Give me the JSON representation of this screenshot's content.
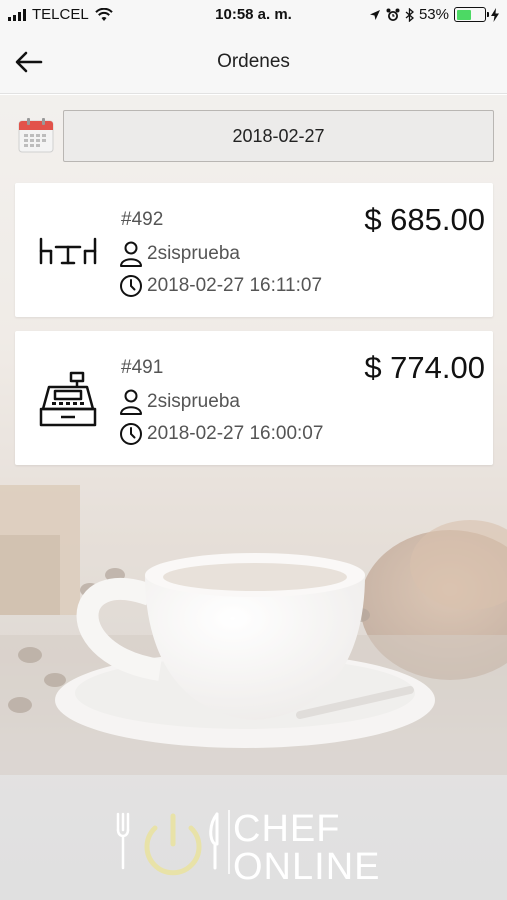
{
  "status_bar": {
    "carrier": "TELCEL",
    "time": "10:58 a. m.",
    "battery_percent": "53%",
    "battery_level": 0.53,
    "icons": [
      "signal-icon",
      "wifi-icon",
      "location-icon",
      "alarm-icon",
      "bluetooth-icon",
      "battery-icon",
      "charging-icon"
    ]
  },
  "nav": {
    "title": "Ordenes",
    "back_icon": "arrow-left-icon"
  },
  "filter": {
    "date": "2018-02-27",
    "calendar_icon": "calendar-icon"
  },
  "orders": [
    {
      "number": "#492",
      "total": "$ 685.00",
      "user": "2sisprueba",
      "datetime": "2018-02-27 16:11:07",
      "type_icon": "table-chairs-icon"
    },
    {
      "number": "#491",
      "total": "$ 774.00",
      "user": "2sisprueba",
      "datetime": "2018-02-27 16:00:07",
      "type_icon": "cash-register-icon"
    }
  ],
  "logo": {
    "line1": "CHEF",
    "line2": "ONLINE"
  },
  "colors": {
    "accent_calendar": "#e2524a",
    "battery": "#4cd964",
    "logo_ring": "#e8e2a8"
  }
}
